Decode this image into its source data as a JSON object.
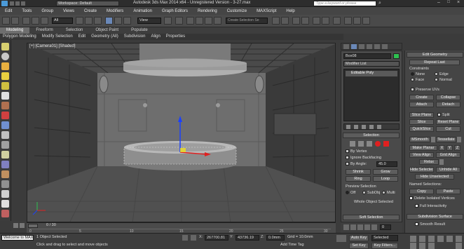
{
  "title_bar": {
    "workspace": "Workspace: Default",
    "title": "Autodesk 3ds Max 2014 x64 - Unregistered Version - 3-27.max",
    "search_placeholder": "Type a keyword or phrase"
  },
  "menu": [
    "Edit",
    "Tools",
    "Group",
    "Views",
    "Create",
    "Modifiers",
    "Animation",
    "Graph Editors",
    "Rendering",
    "Customize",
    "MAXScript",
    "Help"
  ],
  "toolbar": {
    "view_dropdown": "View",
    "selection_set_placeholder": "Create Selection Se"
  },
  "ribbon_tabs": [
    "Modeling",
    "Freeform",
    "Selection",
    "Object Paint",
    "Populate"
  ],
  "ribbon_sub": [
    "Polygon Modeling",
    "Modify Selection",
    "Edit",
    "Geometry (All)",
    "Subdivision",
    "Align",
    "Properties"
  ],
  "viewport": {
    "label": "[+] [Camera01] [Shaded]"
  },
  "modifier_panel": {
    "object_name": "Box08",
    "modifier_list": "Modifier List",
    "stack_item": "Editable Poly",
    "selection_title": "Selection",
    "by_vertex": "By Vertex",
    "ignore_backfacing": "Ignore Backfacing",
    "by_angle": "By Angle:",
    "by_angle_value": "45.0",
    "shrink": "Shrink",
    "grow": "Grow",
    "ring": "Ring",
    "loop": "Loop",
    "preview_selection": "Preview Selection",
    "preview_options": [
      "Off",
      "SubObj",
      "Multi"
    ],
    "whole_object_selected": "Whole Object Selected",
    "soft_selection": "Soft Selection"
  },
  "command_panel": {
    "edit_geometry": "Edit Geometry",
    "repeat_last": "Repeat Last",
    "constraints": "Constraints",
    "constraint_options": [
      "None",
      "Edge",
      "Face",
      "Normal"
    ],
    "preserve_uvs": "Preserve UVs",
    "create": "Create",
    "collapse": "Collapse",
    "attach": "Attach",
    "detach": "Detach",
    "slice_plane": "Slice Plane",
    "split": "Split",
    "slice": "Slice",
    "reset_plane": "Reset Plane",
    "quickslice": "QuickSlice",
    "cut": "Cut",
    "msmooth": "MSmooth",
    "tessellate": "Tessellate",
    "make_planar": "Make Planar",
    "xyz": [
      "X",
      "Y",
      "Z"
    ],
    "view_align": "View Align",
    "grid_align": "Grid Align",
    "relax": "Relax",
    "hide_selected": "Hide Selected",
    "unhide_all": "Unhide All",
    "hide_unselected": "Hide Unselected",
    "named_selections": "Named Selections:",
    "copy": "Copy",
    "paste": "Paste",
    "delete_isolated": "Delete Isolated Vertices",
    "full_interactivity": "Full Interactivity",
    "subdivision_surface": "Subdivision Surface",
    "smooth_result": "Smooth Result"
  },
  "timeline": {
    "frame_counter": "0 / 30",
    "ticks": [
      "0",
      "5",
      "10",
      "15",
      "20",
      "25",
      "30"
    ]
  },
  "status": {
    "maxscript": "Welcome to MAX",
    "objects_selected": "1 Object Selected",
    "prompt": "Click and drag to select and move objects",
    "x_value": "267700.81",
    "y_value": "43736.19",
    "z_value": "0.0mm",
    "grid": "Grid = 10.0mm",
    "add_time_tag": "Add Time Tag",
    "auto_key": "Auto Key",
    "set_key": "Set Key",
    "key_filters": "Key Filters...",
    "selected": "Selected"
  },
  "colors": {
    "accent_blue": "#6a88b8",
    "gizmo_red": "#e02020",
    "gizmo_blue": "#1a40ff",
    "gizmo_yellow": "#f0e020",
    "green_square": "#2ec050"
  }
}
